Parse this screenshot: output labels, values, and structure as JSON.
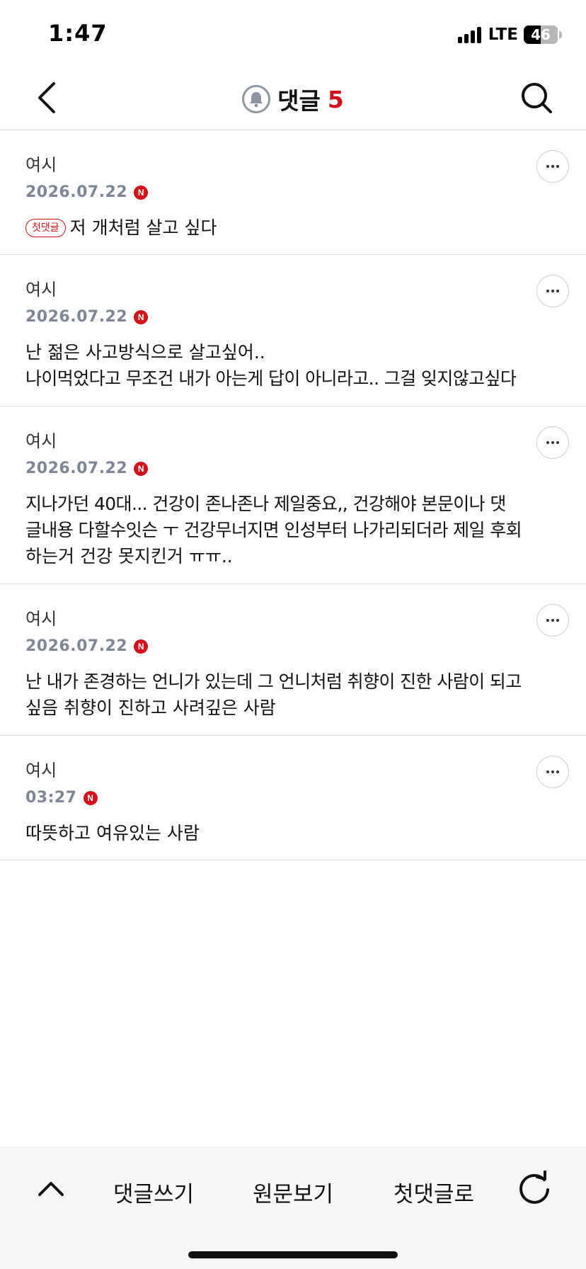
{
  "status_bar": {
    "time": "1:47",
    "network": "LTE",
    "battery": "46"
  },
  "header": {
    "title": "댓글",
    "count": "5",
    "icons": [
      "back-chevron-icon",
      "bell-icon",
      "search-icon"
    ]
  },
  "comments": [
    {
      "author": "여시",
      "date": "2026.07.22",
      "new_badge": "N",
      "first_label": "첫댓글",
      "text": "저 개처럼 살고 싶다"
    },
    {
      "author": "여시",
      "date": "2026.07.22",
      "new_badge": "N",
      "text_lines": [
        "난 젊은 사고방식으로 살고싶어..",
        "나이먹었다고 무조건 내가 아는게 답이 아니라고.. 그걸 잊지않고싶다"
      ]
    },
    {
      "author": "여시",
      "date": "2026.07.22",
      "new_badge": "N",
      "text_lines": [
        "지나가던 40대... 건강이 존나존나 제일중요,, 건강해야 본문이나 댓",
        "글내용 다할수잇슨 ㅜ 건강무너지면 인성부터 나가리되더라 제일 후회",
        "하는거 건강 못지킨거 ㅠㅠ.."
      ]
    },
    {
      "author": "여시",
      "date": "2026.07.22",
      "new_badge": "N",
      "text_lines": [
        "난 내가 존경하는 언니가 있는데 그 언니처럼 취향이 진한 사람이 되고",
        "싶음 취향이 진하고 사려깊은 사람"
      ]
    },
    {
      "author": "여시",
      "date": "03:27",
      "new_badge": "N",
      "text": "따뜻하고 여유있는 사람"
    }
  ],
  "bottom_bar": {
    "write_label": "댓글쓰기",
    "view_original_label": "원문보기",
    "first_comment_label": "첫댓글로",
    "icons": [
      "chevron-up-icon",
      "refresh-icon"
    ]
  },
  "colors": {
    "accent_red": "#d1121b",
    "date_gray": "#7d8694",
    "divider": "#dedede"
  }
}
